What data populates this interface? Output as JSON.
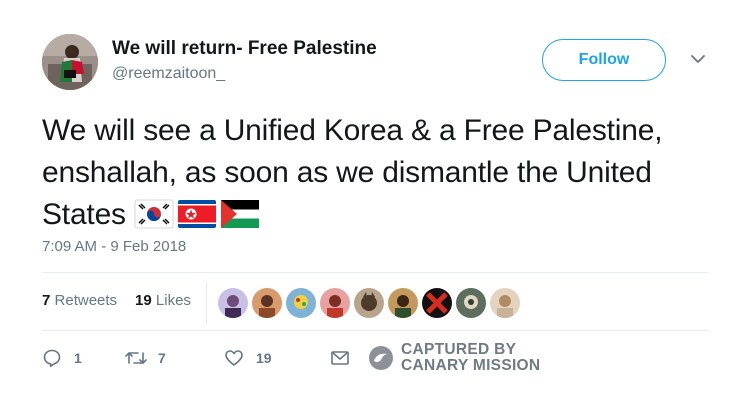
{
  "tweet": {
    "display_name": "We will return- Free Palestine",
    "handle": "@reemzaitoon_",
    "follow_label": "Follow",
    "text": "We will see a Unified Korea & a Free Palestine, enshallah, as soon as we dismantle the United States",
    "flags": [
      "south-korea-flag",
      "north-korea-flag",
      "palestine-flag"
    ],
    "timestamp": "7:09 AM - 9 Feb 2018",
    "stats": {
      "retweets_count": "7",
      "retweets_label": "Retweets",
      "likes_count": "19",
      "likes_label": "Likes"
    },
    "actions": {
      "reply_count": "1",
      "retweet_count": "7",
      "like_count": "19"
    }
  },
  "watermark": {
    "line1": "CAPTURED BY",
    "line2": "CANARY MISSION"
  },
  "colors": {
    "accent": "#1da1f2",
    "secondary_text": "#657786",
    "divider": "#e6ecf0"
  }
}
